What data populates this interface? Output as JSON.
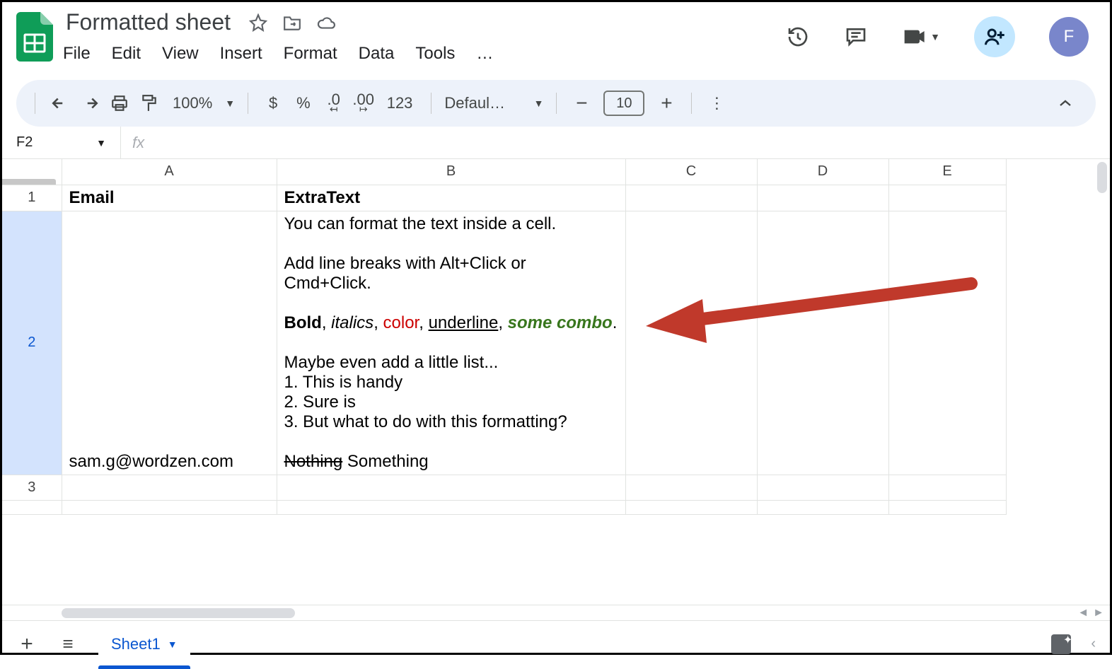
{
  "doc": {
    "title": "Formatted sheet"
  },
  "menus": {
    "file": "File",
    "edit": "Edit",
    "view": "View",
    "insert": "Insert",
    "format": "Format",
    "data": "Data",
    "tools": "Tools",
    "more": "…"
  },
  "avatar": {
    "initial": "F"
  },
  "toolbar": {
    "zoom": "100%",
    "currency": "$",
    "percent": "%",
    "dec_dec": ".0",
    "inc_dec": ".00",
    "num": "123",
    "font": "Defaul…",
    "font_size": "10"
  },
  "namebox": {
    "value": "F2"
  },
  "fx": {
    "label": "fx"
  },
  "columns": {
    "a": "A",
    "b": "B",
    "c": "C",
    "d": "D",
    "e": "E"
  },
  "rows": {
    "r1": "1",
    "r2": "2",
    "r3": "3"
  },
  "cells": {
    "a1": "Email",
    "b1": "ExtraText",
    "a2": "sam.g@wordzen.com",
    "b2_l1": "You can format the text inside a cell.",
    "b2_l2": "Add line breaks with Alt+Click or Cmd+Click.",
    "b2_bold": "Bold",
    "b2_sep1": ", ",
    "b2_ital": "italics",
    "b2_sep2": ", ",
    "b2_color": "color",
    "b2_sep3": ", ",
    "b2_uline": "underline",
    "b2_sep4": ", ",
    "b2_combo": "some combo",
    "b2_sep5": ".",
    "b2_l5": "Maybe even add a little list...",
    "b2_l6": "1. This is handy",
    "b2_l7": "2. Sure is",
    "b2_l8": "3. But what to do with this formatting?",
    "b2_strike": "Nothing",
    "b2_after": " Something"
  },
  "tabs": {
    "sheet1": "Sheet1"
  }
}
